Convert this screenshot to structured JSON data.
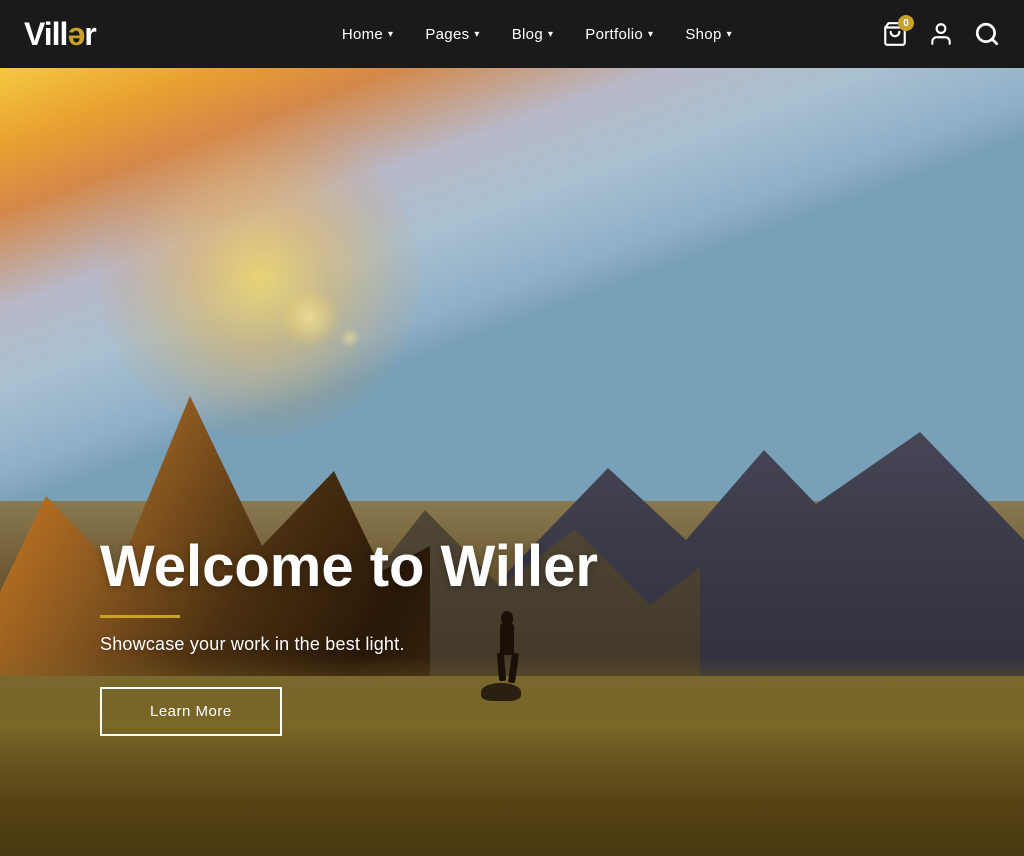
{
  "brand": {
    "name_start": "Vill",
    "name_highlight": "ə",
    "name_end": "r"
  },
  "navbar": {
    "links": [
      {
        "label": "Home",
        "has_dropdown": true
      },
      {
        "label": "Pages",
        "has_dropdown": true
      },
      {
        "label": "Blog",
        "has_dropdown": true
      },
      {
        "label": "Portfolio",
        "has_dropdown": true
      },
      {
        "label": "Shop",
        "has_dropdown": true
      }
    ],
    "cart_count": "0",
    "icons": {
      "cart_label": "Cart",
      "user_label": "User Account",
      "search_label": "Search"
    }
  },
  "hero": {
    "title": "Welcome to Willer",
    "subtitle": "Showcase your work in the best light.",
    "cta_label": "Learn More"
  }
}
